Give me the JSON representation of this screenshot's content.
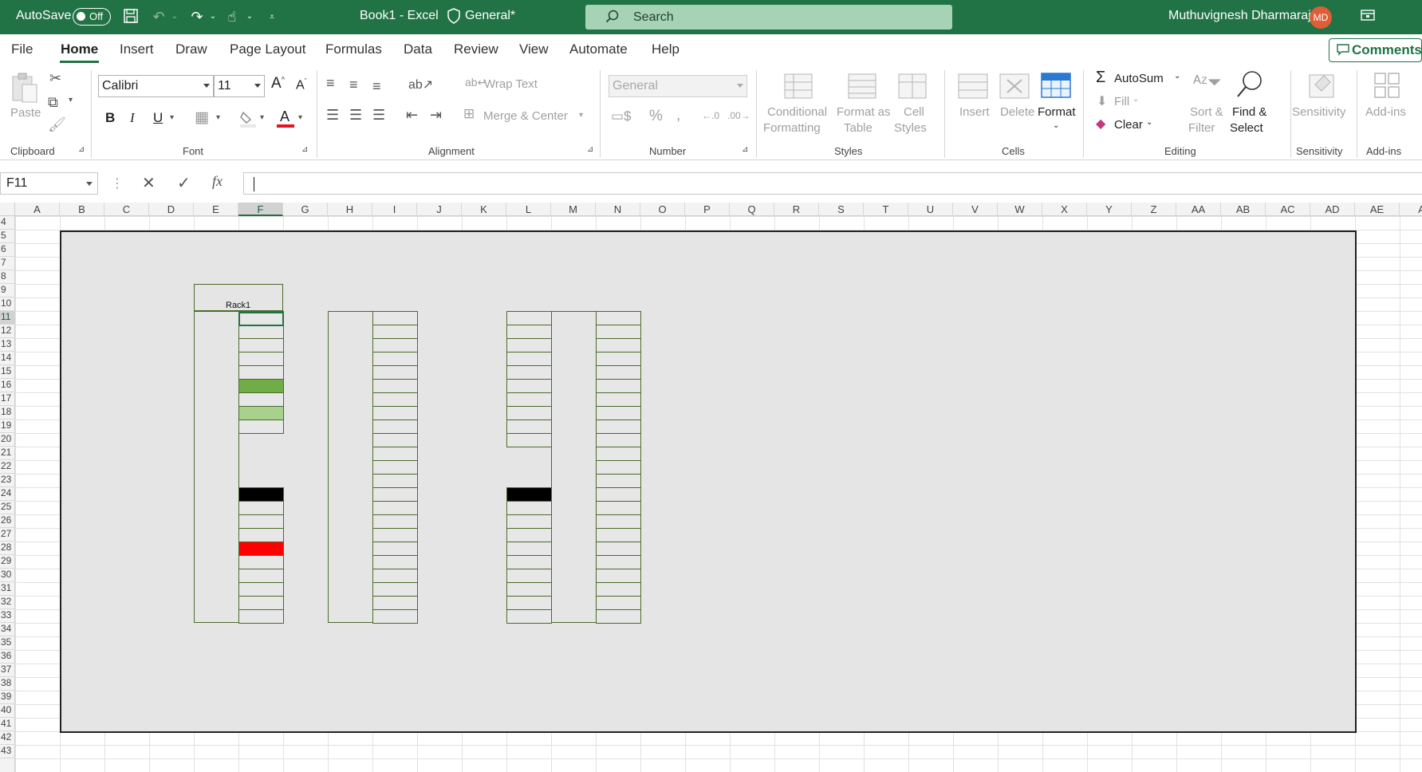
{
  "titlebar": {
    "autosave_label": "AutoSave",
    "autosave_state": "Off",
    "doc_title": "Book1  -  Excel",
    "sensitivity": "General*",
    "search_placeholder": "Search",
    "user_name": "Muthuvignesh Dharmaraj",
    "user_initials": "MD",
    "brand_color": "#217346"
  },
  "menu": {
    "tabs": [
      "File",
      "Home",
      "Insert",
      "Draw",
      "Page Layout",
      "Formulas",
      "Data",
      "Review",
      "View",
      "Automate",
      "Help"
    ],
    "active": "Home",
    "comments": "Comments"
  },
  "ribbon": {
    "clipboard": {
      "paste": "Paste",
      "label": "Clipboard"
    },
    "font": {
      "name": "Calibri",
      "size": "11",
      "bold": "B",
      "italic": "I",
      "underline": "U",
      "label": "Font"
    },
    "alignment": {
      "wrap": "Wrap Text",
      "merge": "Merge & Center",
      "label": "Alignment"
    },
    "number": {
      "format": "General",
      "label": "Number"
    },
    "styles": {
      "conditional_1": "Conditional",
      "conditional_2": "Formatting",
      "format_table_1": "Format as",
      "format_table_2": "Table",
      "cell_styles_1": "Cell",
      "cell_styles_2": "Styles",
      "label": "Styles"
    },
    "cells": {
      "insert": "Insert",
      "delete": "Delete",
      "format": "Format",
      "label": "Cells"
    },
    "editing": {
      "autosum": "AutoSum",
      "fill": "Fill",
      "clear": "Clear",
      "sort_1": "Sort &",
      "sort_2": "Filter",
      "find_1": "Find &",
      "find_2": "Select",
      "label": "Editing"
    },
    "sensitivity": {
      "btn": "Sensitivity",
      "label": "Sensitivity"
    },
    "addins": {
      "btn": "Add-ins",
      "label": "Add-ins"
    }
  },
  "formula_bar": {
    "name_box": "F11",
    "fx": "fx",
    "value": ""
  },
  "sheet": {
    "columns": [
      "A",
      "B",
      "C",
      "D",
      "E",
      "F",
      "G",
      "H",
      "I",
      "J",
      "K",
      "L",
      "M",
      "N",
      "O",
      "P",
      "Q",
      "R",
      "S",
      "T",
      "U",
      "V",
      "W",
      "X",
      "Y",
      "Z",
      "AA",
      "AB",
      "AC",
      "AD",
      "AE",
      "A"
    ],
    "rows": [
      "4",
      "5",
      "6",
      "7",
      "8",
      "9",
      "10",
      "11",
      "12",
      "13",
      "14",
      "15",
      "16",
      "17",
      "18",
      "19",
      "20",
      "21",
      "22",
      "23",
      "24",
      "25",
      "26",
      "27",
      "28",
      "29",
      "30",
      "31",
      "32",
      "33",
      "34",
      "35",
      "36",
      "37",
      "38",
      "39",
      "40",
      "41",
      "42",
      "43"
    ],
    "active_column": "F",
    "active_row": "11",
    "rack_label": "Rack1",
    "highlight_colors": {
      "green_dark": "#70ad47",
      "green_light": "#a9d18e",
      "black": "#000000",
      "red": "#ff0000"
    }
  }
}
